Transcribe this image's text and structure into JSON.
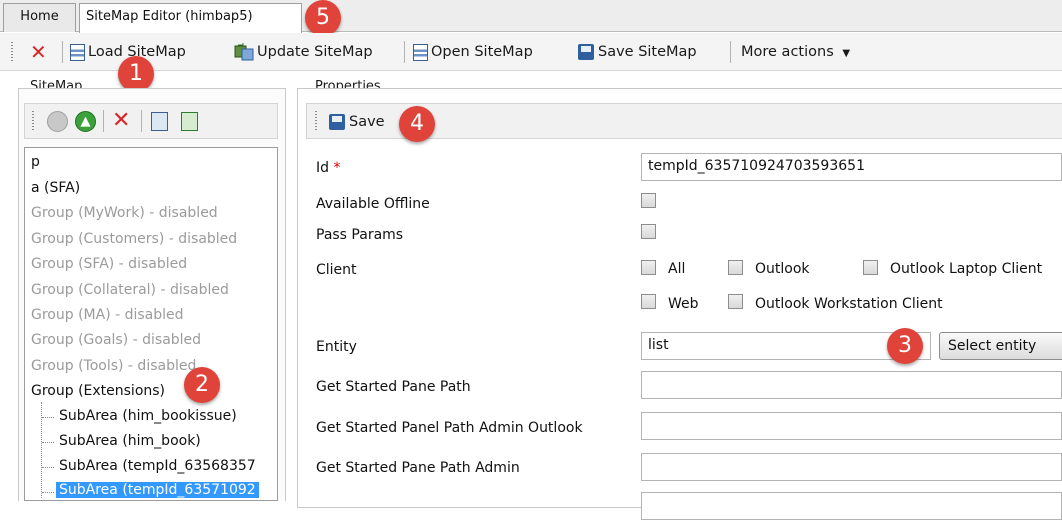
{
  "tabs": {
    "home": "Home",
    "editor": "SiteMap Editor (himbap5)"
  },
  "toolbar": {
    "load": "Load SiteMap",
    "update": "Update SiteMap",
    "open": "Open SiteMap",
    "save": "Save SiteMap",
    "more": "More actions"
  },
  "sitemap_panel": {
    "title": "SiteMap"
  },
  "properties_panel": {
    "title": "Properties",
    "save": "Save"
  },
  "tree": {
    "items": [
      {
        "label": "p",
        "disabled": false
      },
      {
        "label": "a (SFA)",
        "disabled": false
      },
      {
        "label": "Group (MyWork) - disabled",
        "disabled": true
      },
      {
        "label": "Group (Customers) - disabled",
        "disabled": true
      },
      {
        "label": "Group (SFA) - disabled",
        "disabled": true
      },
      {
        "label": "Group (Collateral) - disabled",
        "disabled": true
      },
      {
        "label": "Group (MA) - disabled",
        "disabled": true
      },
      {
        "label": "Group (Goals) - disabled",
        "disabled": true
      },
      {
        "label": "Group (Tools) - disabled",
        "disabled": true
      },
      {
        "label": "Group (Extensions)",
        "disabled": false
      }
    ],
    "subareas": [
      {
        "label": "SubArea (him_bookissue)",
        "selected": false
      },
      {
        "label": "SubArea (him_book)",
        "selected": false
      },
      {
        "label": "SubArea (tempId_63568357",
        "selected": false
      },
      {
        "label": "SubArea (tempId_63571092",
        "selected": true
      }
    ]
  },
  "form": {
    "id_label": "Id",
    "id_required": "*",
    "id_value": "tempId_635710924703593651",
    "available_offline": "Available Offline",
    "pass_params": "Pass Params",
    "client": "Client",
    "client_options": {
      "all": "All",
      "outlook": "Outlook",
      "outlook_laptop": "Outlook Laptop Client",
      "web": "Web",
      "outlook_workstation": "Outlook Workstation Client"
    },
    "entity_label": "Entity",
    "entity_value": "list",
    "select_entity": "Select entity",
    "get_started_pane_path": "Get Started Pane Path",
    "get_started_panel_path_admin_outlook": "Get Started Panel Path Admin Outlook",
    "get_started_pane_path_admin": "Get Started Pane Path Admin"
  },
  "callouts": [
    "1",
    "2",
    "3",
    "4",
    "5"
  ],
  "colors": {
    "callout": "#e0433a",
    "selection": "#3399ff"
  }
}
